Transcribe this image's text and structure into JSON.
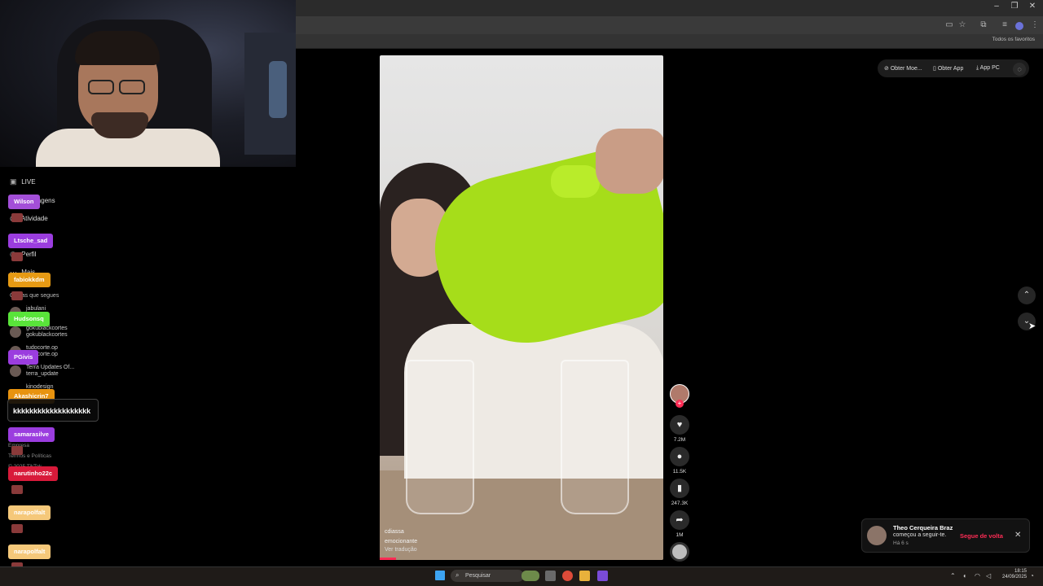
{
  "browser": {
    "window_controls": [
      "–",
      "❐",
      "✕"
    ],
    "bookmarks_label": "Todos os favoritos"
  },
  "sidebar": {
    "items": [
      {
        "label": "LIVE",
        "icon": "live-icon"
      },
      {
        "label": "Mensagens",
        "icon": "messages-icon"
      },
      {
        "label": "Atividade",
        "icon": "activity-icon"
      },
      {
        "label": "Perfil",
        "icon": "profile-icon"
      },
      {
        "label": "Mais",
        "icon": "more-icon"
      }
    ],
    "following_title": "Contas que segues",
    "following": [
      {
        "name": "jabulani",
        "handle": "jabulanii"
      },
      {
        "name": "gokublackcortes",
        "handle": "gokublackcortes"
      },
      {
        "name": "tudocorte.op",
        "handle": "tudocorte.op"
      },
      {
        "name": "Terra Updates Of...",
        "handle": "terra_update"
      },
      {
        "name": "kinodesign",
        "handle": ""
      }
    ],
    "footer": [
      "Empresa",
      "Termos e Políticas",
      "© 2025 TikTok"
    ]
  },
  "chat": {
    "users": [
      {
        "name": "Wilson",
        "color": "#a34fd8"
      },
      {
        "name": "Ltsche_sad",
        "color": "#9b3ddf"
      },
      {
        "name": "fabiokkdm",
        "color": "#e69a14"
      },
      {
        "name": "Hudsonsq",
        "color": "#59e43a"
      },
      {
        "name": "PGivis",
        "color": "#9b3ddf"
      },
      {
        "name": "Akashicrin7",
        "color": "#e8930f"
      },
      {
        "name": "samarasilve",
        "color": "#9b3ddf"
      },
      {
        "name": "narutinho22c",
        "color": "#d81a3a"
      },
      {
        "name": "narapolfalt",
        "color": "#f5c87a"
      },
      {
        "name": "narapolfalt",
        "color": "#f5c87a"
      }
    ],
    "message": "kkkkkkkkkkkkkkkkkkk"
  },
  "video": {
    "author": "cdiassa",
    "description": "emocionante",
    "translate": "Ver tradução",
    "likes": "7.2M",
    "comments": "11.5K",
    "saves": "247.3K",
    "shares": "1M"
  },
  "top_actions": {
    "coins": "Obter Moe...",
    "app": "Obter App",
    "pc": "App PC"
  },
  "notification": {
    "name": "Theo Cerqueira Braz",
    "text": "começou a seguir-te.",
    "time": "Há 6 s",
    "follow_back": "Segue de volta",
    "close": "✕"
  },
  "taskbar": {
    "search_placeholder": "Pesquisar",
    "time": "18:15",
    "date": "24/09/2025"
  },
  "colors": {
    "tiktok_red": "#fe2c55",
    "pitcher_green": "#a6dd1a"
  }
}
